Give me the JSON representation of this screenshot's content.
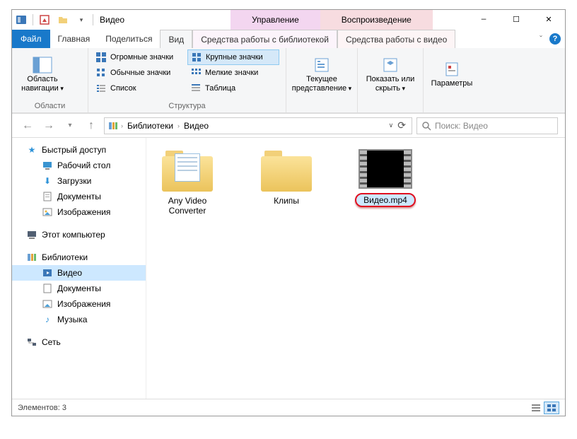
{
  "title": "Видео",
  "context_tabs": {
    "manage": "Управление",
    "play": "Воспроизведение"
  },
  "wincontrols": {
    "min": "—",
    "max": "☐",
    "close": "✕"
  },
  "ribbon_tabs": {
    "file": "Файл",
    "home": "Главная",
    "share": "Поделиться",
    "view": "Вид",
    "ctx1": "Средства работы с библиотекой",
    "ctx2": "Средства работы с видео",
    "caret": "ˇ"
  },
  "ribbon": {
    "navpane": {
      "label": "Область навигации",
      "group": "Области"
    },
    "layout": {
      "items": {
        "xlarge": "Огромные значки",
        "large": "Крупные значки",
        "normal": "Обычные значки",
        "small": "Мелкие значки",
        "list": "Список",
        "table": "Таблица"
      },
      "group": "Структура"
    },
    "currentview": {
      "label": "Текущее представление"
    },
    "showhide": {
      "label": "Показать или скрыть"
    },
    "options": {
      "label": "Параметры"
    }
  },
  "address": {
    "crumbs": [
      "Библиотеки",
      "Видео"
    ],
    "search_placeholder": "Поиск: Видео"
  },
  "sidebar": {
    "quick": {
      "head": "Быстрый доступ",
      "items": [
        "Рабочий стол",
        "Загрузки",
        "Документы",
        "Изображения"
      ]
    },
    "thispc": {
      "head": "Этот компьютер"
    },
    "libraries": {
      "head": "Библиотеки",
      "items": [
        "Видео",
        "Документы",
        "Изображения",
        "Музыка"
      ]
    },
    "network": {
      "head": "Сеть"
    }
  },
  "files": {
    "anyvideo": "Any Video Converter",
    "clips": "Клипы",
    "videomp4": "Видео.mp4"
  },
  "status": {
    "count_label": "Элементов:",
    "count": "3"
  }
}
